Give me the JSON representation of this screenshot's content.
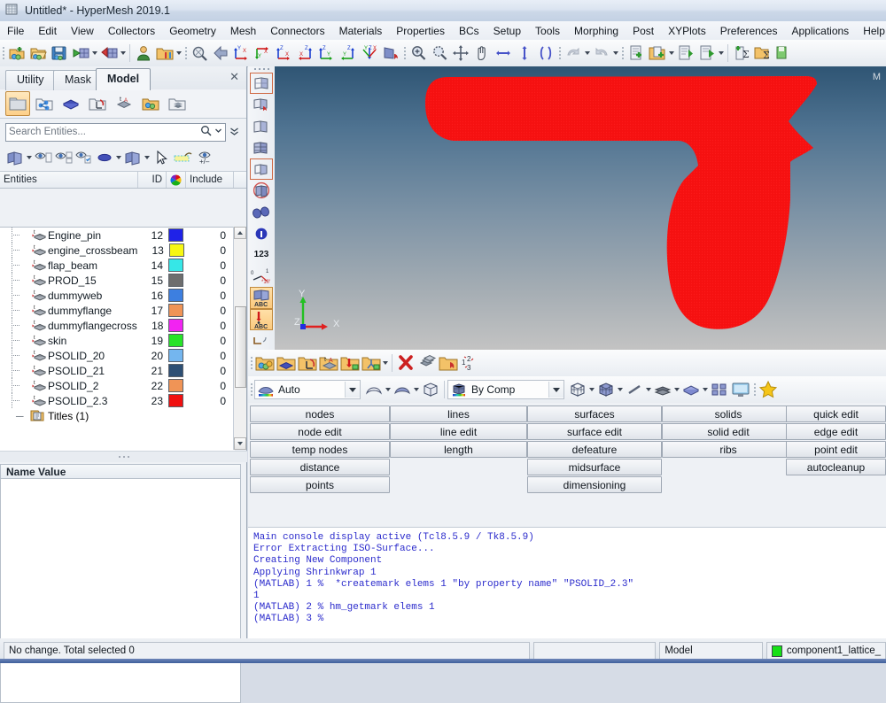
{
  "window": {
    "title": "Untitled* - HyperMesh 2019.1",
    "app_icon": "hypermesh-logo-icon"
  },
  "menubar": {
    "items": [
      {
        "label": "File",
        "name": "menu-file"
      },
      {
        "label": "Edit",
        "name": "menu-edit"
      },
      {
        "label": "View",
        "name": "menu-view"
      },
      {
        "label": "Collectors",
        "name": "menu-collectors"
      },
      {
        "label": "Geometry",
        "name": "menu-geometry"
      },
      {
        "label": "Mesh",
        "name": "menu-mesh"
      },
      {
        "label": "Connectors",
        "name": "menu-connectors"
      },
      {
        "label": "Materials",
        "name": "menu-materials"
      },
      {
        "label": "Properties",
        "name": "menu-properties"
      },
      {
        "label": "BCs",
        "name": "menu-bcs"
      },
      {
        "label": "Setup",
        "name": "menu-setup"
      },
      {
        "label": "Tools",
        "name": "menu-tools"
      },
      {
        "label": "Morphing",
        "name": "menu-morphing"
      },
      {
        "label": "Post",
        "name": "menu-post"
      },
      {
        "label": "XYPlots",
        "name": "menu-xyplots"
      },
      {
        "label": "Preferences",
        "name": "menu-preferences"
      },
      {
        "label": "Applications",
        "name": "menu-applications"
      },
      {
        "label": "Help",
        "name": "menu-help"
      }
    ]
  },
  "toolbar": {
    "icons": [
      "new-model-icon",
      "open-model-icon",
      "save-model-icon",
      "import-icon",
      "export-icon",
      "user-profile-icon",
      "load-userprofile-icon",
      "zoom-fit-icon",
      "previous-view-icon",
      "view-xy-icon",
      "view-yx-icon",
      "view-zx-icon",
      "view-xz-icon",
      "view-zy-icon",
      "view-yz-icon",
      "view-isometric-icon",
      "view-normal-icon",
      "zoom-in-icon",
      "zoom-window-icon",
      "fit-icon",
      "pan-icon",
      "rotate-horizontal-icon",
      "rotate-vertical-icon",
      "rotate-free-icon",
      "undo-icon",
      "redo-icon",
      "page-add-icon",
      "page-copy-icon",
      "page-delete-icon",
      "page-next-icon",
      "summary-add-icon",
      "summary-open-icon",
      "summary-save-icon"
    ]
  },
  "left_panel": {
    "tabs": [
      {
        "label": "Utility",
        "active": false,
        "name": "tab-utility"
      },
      {
        "label": "Mask",
        "active": false,
        "name": "tab-mask"
      },
      {
        "label": "Model",
        "active": true,
        "name": "tab-model"
      }
    ],
    "close_label": "✕",
    "browser_icons": [
      "model-folder-icon",
      "connectors-icon",
      "properties-icon",
      "load-collectors-icon",
      "titles-icon",
      "components-icon",
      "stacked-plies-icon"
    ],
    "search": {
      "placeholder": "Search Entities...",
      "value": "",
      "search_icon": "search-icon",
      "dropdown_icon": "chevron-down-icon",
      "expand_icon": "double-chevron-down-icon"
    },
    "view_tools": [
      "display-all-icon",
      "hide-icon",
      "isolate-icon",
      "isolate-only-icon",
      "shade-icon",
      "element-display-icon",
      "select-arrow-icon",
      "highlight-icon",
      "visibility-plus-minus-icon"
    ],
    "entity_headers": [
      "Entities",
      "ID",
      "",
      "Include"
    ],
    "color_header_icon": "color-wheel-icon",
    "entities": [
      {
        "name": "Engine_pin",
        "id": "12",
        "color": "#1f22e8",
        "include": "0"
      },
      {
        "name": "engine_crossbeam",
        "id": "13",
        "color": "#f7f713",
        "include": "0"
      },
      {
        "name": "flap_beam",
        "id": "14",
        "color": "#36e7e7",
        "include": "0"
      },
      {
        "name": "PROD_15",
        "id": "15",
        "color": "#6e6e6e",
        "include": "0"
      },
      {
        "name": "dummyweb",
        "id": "16",
        "color": "#3d7fe0",
        "include": "0"
      },
      {
        "name": "dummyflange",
        "id": "17",
        "color": "#f09456",
        "include": "0"
      },
      {
        "name": "dummyflangecross",
        "id": "18",
        "color": "#f223f2",
        "include": "0"
      },
      {
        "name": "skin",
        "id": "19",
        "color": "#27e327",
        "include": "0"
      },
      {
        "name": "PSOLID_20",
        "id": "20",
        "color": "#74b6ef",
        "include": "0"
      },
      {
        "name": "PSOLID_21",
        "id": "21",
        "color": "#2d4f74",
        "include": "0"
      },
      {
        "name": "PSOLID_2",
        "id": "22",
        "color": "#f09456",
        "include": "0"
      },
      {
        "name": "PSOLID_2.3",
        "id": "23",
        "color": "#f01010",
        "include": "0"
      }
    ],
    "entity_row_icon": "component-entity-icon",
    "titles_node": {
      "label": "Titles (1)",
      "icon": "titles-folder-icon"
    },
    "name_value_header": "Name Value"
  },
  "viewport": {
    "corner_label": "M",
    "background_top_color": "#2f5574",
    "background_bottom_color": "#c3c3c3",
    "mesh_color": "#f81010",
    "triad": {
      "x_label": "X",
      "y_label": "Y",
      "z_label": "Z",
      "x_color": "#e01010",
      "y_color": "#10c010",
      "z_color": "#1010d0"
    },
    "side_tools": [
      "geometry-display-icon",
      "mesh-lines-icon",
      "feature-lines-icon",
      "wireframe-icon",
      "shaded-elements-icon",
      "shaded-with-edges-icon",
      "find-icon",
      "info-icon",
      "numbers-icon",
      "measure-icon",
      "mesh-abc-icon",
      "load-abc-icon",
      "plot-icon"
    ]
  },
  "lower_toolbars": {
    "row1_icons": [
      "component-collector-icon",
      "property-collector-icon",
      "load-collector-icon",
      "title-collector-icon",
      "include-collector-icon",
      "assembly-collector-icon",
      "delete-icon",
      "organize-icon",
      "renumber-collector-icon",
      "renumber-icon"
    ],
    "row2": {
      "mesh_mode_label": "Auto",
      "mesh_mode_icon": "shaded-surface-icon",
      "surface_icon": "surface-icon",
      "shaded_surface_icon": "shaded-surface-edges-icon",
      "solid_icon": "solid-cube-icon",
      "color_mode_label": "By Comp",
      "color_mode_icon": "by-comp-icon",
      "wireframe_elems_icon": "wireframe-elements-icon",
      "shaded_elems_icon": "shaded-elements-cube-icon",
      "line_icon": "line-display-icon",
      "mesh_layers_icon": "mesh-layers-icon",
      "shaded_plate_icon": "shaded-plate-icon",
      "grid_icon": "grid-layout-icon",
      "screen_icon": "screen-icon",
      "favorite_icon": "star-icon"
    }
  },
  "panel_grid": {
    "columns": [
      {
        "name": "column-geom-1",
        "buttons": [
          "nodes",
          "node edit",
          "temp nodes",
          "distance",
          "points"
        ]
      },
      {
        "name": "column-geom-2",
        "buttons": [
          "lines",
          "line edit",
          "length"
        ]
      },
      {
        "name": "column-geom-3",
        "buttons": [
          "surfaces",
          "surface edit",
          "defeature",
          "midsurface",
          "dimensioning"
        ]
      },
      {
        "name": "column-geom-4",
        "buttons": [
          "solids",
          "solid edit",
          "ribs"
        ]
      },
      {
        "name": "column-geom-5",
        "buttons": [
          "quick edit",
          "edge edit",
          "point edit",
          "autocleanup"
        ]
      }
    ]
  },
  "console": {
    "lines": [
      "Main console display active (Tcl8.5.9 / Tk8.5.9)",
      "Error Extracting ISO-Surface...",
      "Creating New Component",
      "Applying Shrinkwrap 1",
      "(MATLAB) 1 %  *createmark elems 1 \"by property name\" \"PSOLID_2.3\"",
      "1",
      "(MATLAB) 2 % hm_getmark elems 1",
      "(MATLAB) 3 %"
    ],
    "text": "Main console display active (Tcl8.5.9 / Tk8.5.9)\nError Extracting ISO-Surface...\nCreating New Component\nApplying Shrinkwrap 1\n(MATLAB) 1 %  *createmark elems 1 \"by property name\" \"PSOLID_2.3\"\n1\n(MATLAB) 2 % hm_getmark elems 1\n(MATLAB) 3 %"
  },
  "statusbar": {
    "message": "No change. Total selected 0",
    "field_blank": "",
    "browser_label": "Model",
    "current_component": "component1_lattice_",
    "current_component_color": "#16e016"
  }
}
